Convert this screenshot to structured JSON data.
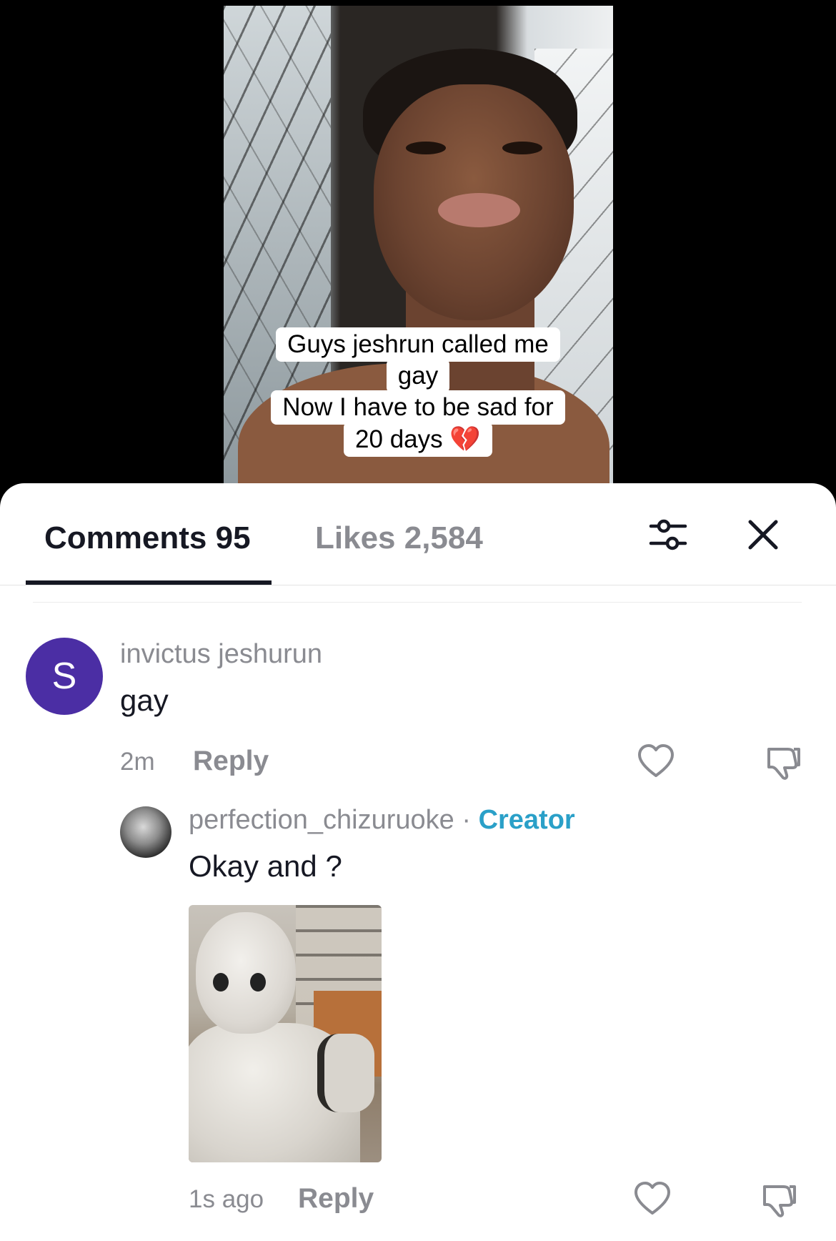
{
  "video": {
    "caption_lines": [
      "Guys jeshrun called me",
      "gay",
      "Now I have to be sad for",
      "20 days 💔"
    ]
  },
  "sheet": {
    "tabs": [
      {
        "label": "Comments 95",
        "active": true
      },
      {
        "label": "Likes 2,584",
        "active": false
      }
    ],
    "icons": {
      "filter": "sliders-icon",
      "close": "close-icon"
    }
  },
  "comments": [
    {
      "avatar_letter": "S",
      "avatar_color": "#4b2ea4",
      "username": "invictus jeshurun",
      "text": "gay",
      "time": "2m",
      "reply_label": "Reply",
      "icons": [
        "heart-icon",
        "dislike-icon"
      ]
    },
    {
      "username": "perfection_chizuruoke",
      "separator": "·",
      "badge": "Creator",
      "badge_color": "#2aa0c8",
      "text": "Okay and ?",
      "attachment": "robot-sticker",
      "time": "1s ago",
      "reply_label": "Reply",
      "icons": [
        "heart-icon",
        "dislike-icon"
      ]
    }
  ]
}
